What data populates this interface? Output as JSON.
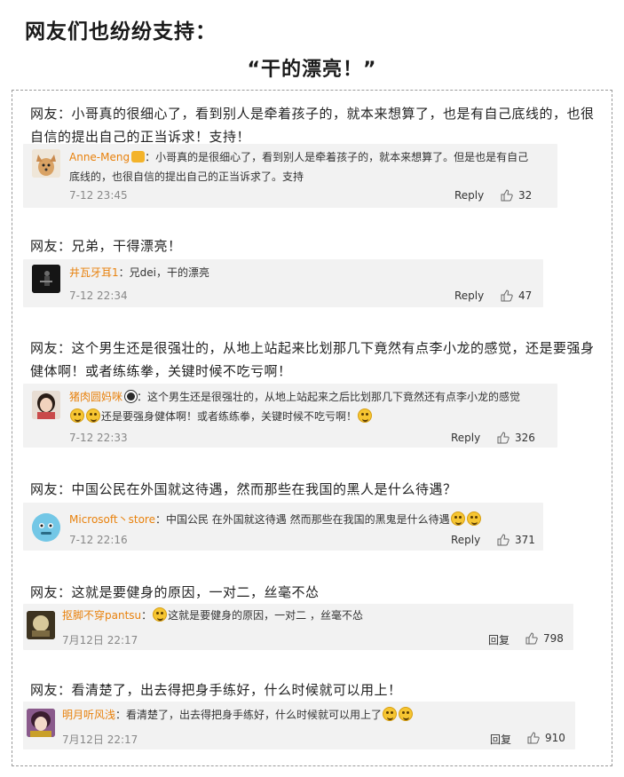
{
  "heading": "网友们也纷纷支持：",
  "subheading": "“干的漂亮！”",
  "reply_label": "Reply",
  "reply_label_cn": "回复",
  "comments": [
    {
      "netizen": "网友：小哥真的很细心了，看到别人是牵着孩子的，就本来想算了，也是有自己底线的，也很自信的提出自己的正当诉求！支持！",
      "user": "Anne-Meng",
      "text_line1": "：小哥真的是很细心了，看到别人是牵着孩子的，就本来想算了。但是也是有自己",
      "text_line2": "底线的，也很自信的提出自己的正当诉求了。支持",
      "date": "7-12 23:45",
      "likes": "32"
    },
    {
      "netizen": "网友：兄弟，干得漂亮！",
      "user": "井瓦牙耳1",
      "text_line1": "：兄dei，干的漂亮",
      "date": "7-12 22:34",
      "likes": "47"
    },
    {
      "netizen": "网友：这个男生还是很强壮的，从地上站起来比划那几下竟然有点李小龙的感觉，还是要强身健体啊！或者练练拳，关键时候不吃亏啊！",
      "user": "猪肉圆妈咪",
      "text_line1": "：这个男生还是很强壮的，从地上站起来之后比划那几下竟然还有点李小龙的感觉",
      "text_line2": "还是要强身健体啊！或者练练拳，关键时候不吃亏啊！",
      "date": "7-12 22:33",
      "likes": "326"
    },
    {
      "netizen": "网友：中国公民在外国就这待遇，然而那些在我国的黑人是什么待遇？",
      "user": "Microsoft丶store",
      "text_line1": "：中国公民 在外国就这待遇 然而那些在我国的黑鬼是什么待遇",
      "date": "7-12 22:16",
      "likes": "371"
    },
    {
      "netizen": "网友：这就是要健身的原因，一对二，丝毫不怂",
      "user": "抠脚不穿pantsu",
      "text_line1": "这就是要健身的原因，一对二 ，丝毫不怂",
      "date": "7月12日 22:17",
      "likes": "798"
    },
    {
      "netizen": "网友：看清楚了，出去得把身手练好，什么时候就可以用上！",
      "user": "明月听风浅",
      "text_line1": "：看清楚了，出去得把身手练好，什么时候就可以用上了",
      "date": "7月12日 22:17",
      "likes": "910"
    }
  ]
}
